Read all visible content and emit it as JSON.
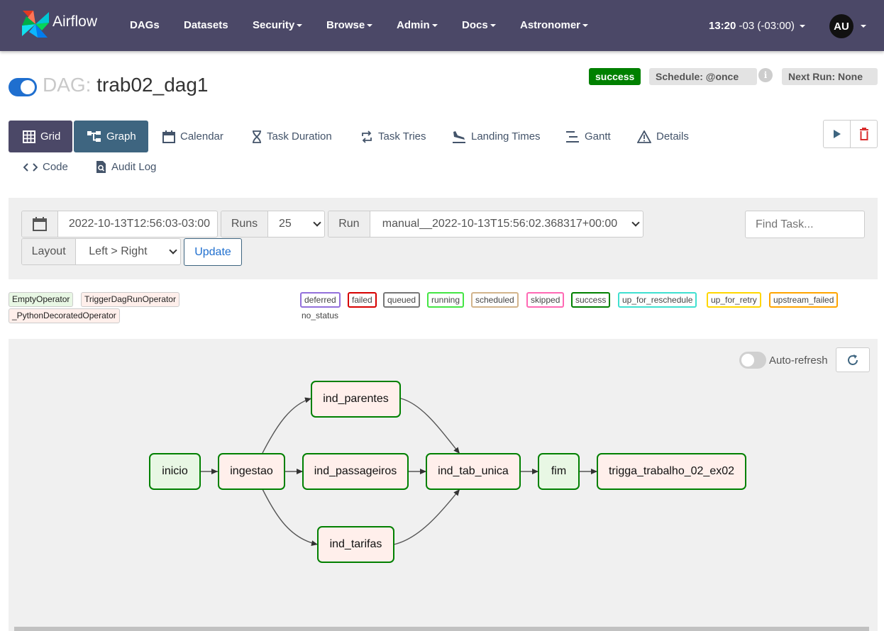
{
  "nav": {
    "brand": "Airflow",
    "items": [
      "DAGs",
      "Datasets",
      "Security",
      "Browse",
      "Admin",
      "Docs",
      "Astronomer"
    ],
    "clock_time": "13:20",
    "clock_tz": " -03 (-03:00)",
    "user_initials": "AU"
  },
  "dag": {
    "prefix": "DAG: ",
    "name": "trab02_dag1",
    "status": "success",
    "schedule": "Schedule: @once",
    "next_run": "Next Run: None"
  },
  "tabs": [
    "Grid",
    "Graph",
    "Calendar",
    "Task Duration",
    "Task Tries",
    "Landing Times",
    "Gantt",
    "Details",
    "Code",
    "Audit Log"
  ],
  "filters": {
    "date": "2022-10-13T12:56:03-03:00",
    "runs_label": "Runs",
    "runs_value": "25",
    "run_label": "Run",
    "run_value": "manual__2022-10-13T15:56:02.368317+00:00",
    "layout_label": "Layout",
    "layout_value": "Left > Right",
    "update_label": "Update",
    "find_placeholder": "Find Task..."
  },
  "legend": {
    "operators": [
      "EmptyOperator",
      "TriggerDagRunOperator",
      "_PythonDecoratedOperator"
    ],
    "states": [
      "deferred",
      "failed",
      "queued",
      "running",
      "scheduled",
      "skipped",
      "success",
      "up_for_reschedule",
      "up_for_retry",
      "upstream_failed"
    ],
    "no_status": "no_status"
  },
  "graph": {
    "auto_refresh_label": "Auto-refresh",
    "nodes": [
      "inicio",
      "ingestao",
      "ind_parentes",
      "ind_passageiros",
      "ind_tarifas",
      "ind_tab_unica",
      "fim",
      "trigga_trabalho_02_ex02"
    ]
  },
  "colors": {
    "navbar": "#4b4867",
    "success": "#008000",
    "empty_operator_bg": "#e8f7e4",
    "python_operator_bg": "#ffefeb"
  }
}
